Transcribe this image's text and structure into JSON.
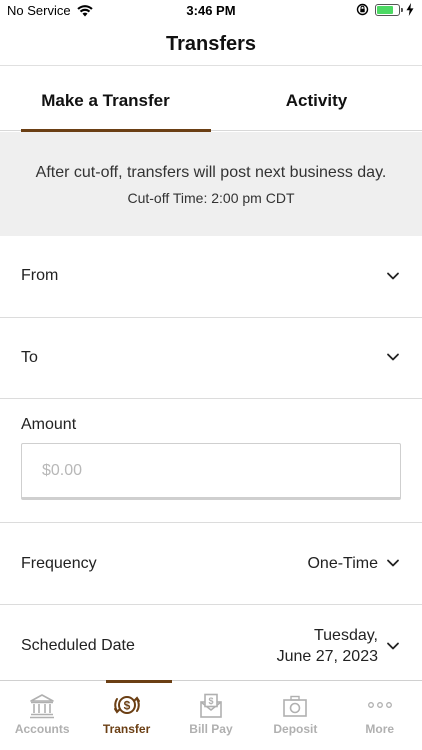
{
  "status_bar": {
    "carrier": "No Service",
    "time": "3:46 PM",
    "battery_level": 0.75
  },
  "header": {
    "title": "Transfers"
  },
  "tabs": [
    {
      "label": "Make a Transfer",
      "active": true
    },
    {
      "label": "Activity",
      "active": false
    }
  ],
  "notice": {
    "line1": "After cut-off, transfers will post next business day.",
    "line2": "Cut-off Time: 2:00 pm CDT"
  },
  "form": {
    "from_label": "From",
    "to_label": "To",
    "amount_label": "Amount",
    "amount_placeholder": "$0.00",
    "frequency_label": "Frequency",
    "frequency_value": "One-Time",
    "scheduled_date_label": "Scheduled Date",
    "scheduled_date_line1": "Tuesday,",
    "scheduled_date_line2": "June 27, 2023"
  },
  "bottom_nav": [
    {
      "label": "Accounts",
      "icon": "bank-icon",
      "active": false
    },
    {
      "label": "Transfer",
      "icon": "transfer-dollar-icon",
      "active": true
    },
    {
      "label": "Bill Pay",
      "icon": "bill-pay-icon",
      "active": false
    },
    {
      "label": "Deposit",
      "icon": "camera-deposit-icon",
      "active": false
    },
    {
      "label": "More",
      "icon": "more-dots-icon",
      "active": false
    }
  ],
  "colors": {
    "accent": "#6b3f14",
    "notice_bg": "#efefef",
    "inactive_nav": "#b0b0b0"
  }
}
